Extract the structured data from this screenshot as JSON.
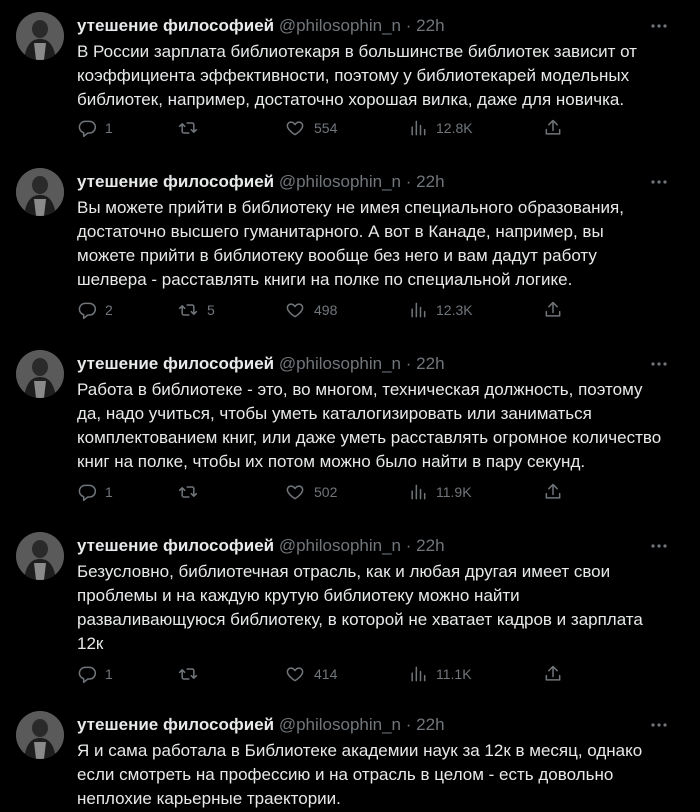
{
  "thread": {
    "tweets": [
      {
        "name": "утешение философией",
        "handle": "@philosophin_n",
        "dot": "·",
        "time": "22h",
        "text": "В России зарплата библиотекаря в большинстве библиотек зависит от\nкоэффициента эффективности, поэтому у библиотекарей модельных\nбиблиотек, например, достаточно хорошая вилка, даже для новичка.",
        "replies": "1",
        "retweets": "",
        "likes": "554",
        "views": "12.8K"
      },
      {
        "name": "утешение философией",
        "handle": "@philosophin_n",
        "dot": "·",
        "time": "22h",
        "text": "Вы можете прийти в библиотеку не имея специального образования,\nдостаточно высшего гуманитарного. А вот в Канаде, например, вы\nможете прийти в библиотеку вообще без него и вам дадут работу\nшелвера - расставлять книги на полке по специальной логике.",
        "replies": "2",
        "retweets": "5",
        "likes": "498",
        "views": "12.3K"
      },
      {
        "name": "утешение философией",
        "handle": "@philosophin_n",
        "dot": "·",
        "time": "22h",
        "text": "Работа в библиотеке - это, во многом, техническая должность, поэтому\nда, надо учиться, чтобы уметь каталогизировать или заниматься\nкомплектованием книг, или даже уметь расставлять огромное количество\nкниг на полке, чтобы их потом можно было найти в пару секунд.",
        "replies": "1",
        "retweets": "",
        "likes": "502",
        "views": "11.9K"
      },
      {
        "name": "утешение философией",
        "handle": "@philosophin_n",
        "dot": "·",
        "time": "22h",
        "text": "Безусловно, библиотечная отрасль, как и любая другая имеет свои\nпроблемы и на каждую крутую библиотеку можно найти\nразваливающуюся библиотеку, в которой не хватает кадров и зарплата\n12к",
        "replies": "1",
        "retweets": "",
        "likes": "414",
        "views": "11.1K"
      },
      {
        "name": "утешение философией",
        "handle": "@philosophin_n",
        "dot": "·",
        "time": "22h",
        "text": "Я и сама работала в Библиотеке академии наук за 12к в месяц, однако\nесли смотреть на профессию и на отрасль в целом - есть довольно\nнеплохие карьерные траектории."
      }
    ]
  },
  "icons": {
    "reply": "reply-icon",
    "retweet": "retweet-icon",
    "like": "heart-icon",
    "views": "views-icon",
    "share": "share-icon",
    "more": "more-icon"
  },
  "colors": {
    "background": "#000000",
    "text": "#e7e9ea",
    "muted": "#71767b"
  }
}
